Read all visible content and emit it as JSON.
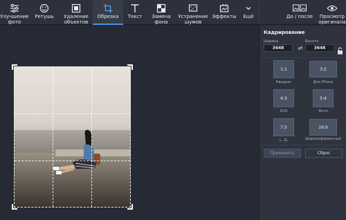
{
  "toolbar": {
    "items": [
      {
        "label": "Улучшение\nфото",
        "icon": "sliders-icon"
      },
      {
        "label": "Ретушь",
        "icon": "face-retouch-icon"
      },
      {
        "label": "Удаление\nобъектов",
        "icon": "object-removal-icon"
      },
      {
        "label": "Обрезка",
        "icon": "crop-icon",
        "active": true
      },
      {
        "label": "Текст",
        "icon": "text-icon"
      },
      {
        "label": "Замена\nфона",
        "icon": "background-replace-icon"
      },
      {
        "label": "Устранение\nшумов",
        "icon": "denoise-icon"
      },
      {
        "label": "Эффекты",
        "icon": "effects-icon"
      },
      {
        "label": "Ещё",
        "icon": "chevron-down-icon"
      }
    ],
    "before_after": "До / после",
    "view_original": "Просмотр\nоригинала"
  },
  "panel": {
    "title": "Кадрирование",
    "width_label": "Ширина",
    "height_label": "Высота",
    "width_value": "3648",
    "height_value": "3648",
    "ratios": [
      {
        "ratio": "1:1",
        "label": "Квадрат"
      },
      {
        "ratio": "3:2",
        "label": "Для iPhone"
      },
      {
        "ratio": "4:3",
        "label": "DVD"
      },
      {
        "ratio": "5:4",
        "label": "Фото"
      },
      {
        "ratio": "7:5",
        "label": "L, 2L"
      },
      {
        "ratio": "16:9",
        "label": "Широкоформатный"
      }
    ],
    "apply_label": "Применить",
    "reset_label": "Сброс"
  },
  "colors": {
    "accent": "#4a90e2",
    "panel_bg": "#2e333e",
    "canvas_bg": "#262a34"
  }
}
